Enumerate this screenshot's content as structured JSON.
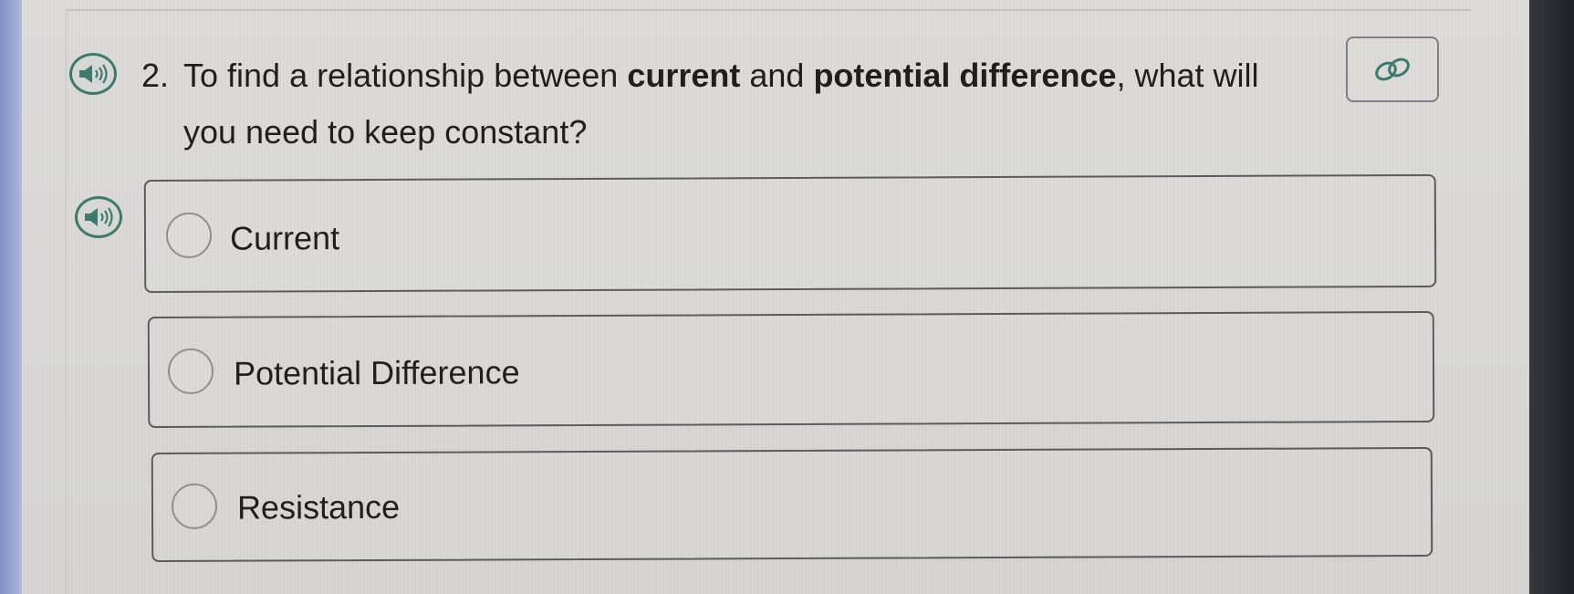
{
  "question": {
    "number": "2.",
    "text_part1": "To find a relationship between ",
    "bold1": "current",
    "text_part2": " and ",
    "bold2": "potential difference",
    "text_part3": ", what will you need to keep constant?"
  },
  "icons": {
    "question_audio": "speaker-icon",
    "options_audio": "speaker-icon",
    "link": "link-icon"
  },
  "options": [
    {
      "label": "Current"
    },
    {
      "label": "Potential Difference"
    },
    {
      "label": "Resistance"
    }
  ],
  "colors": {
    "accent": "#3d7a6e",
    "text": "#1f1f1f",
    "border": "#5a5b5e"
  }
}
